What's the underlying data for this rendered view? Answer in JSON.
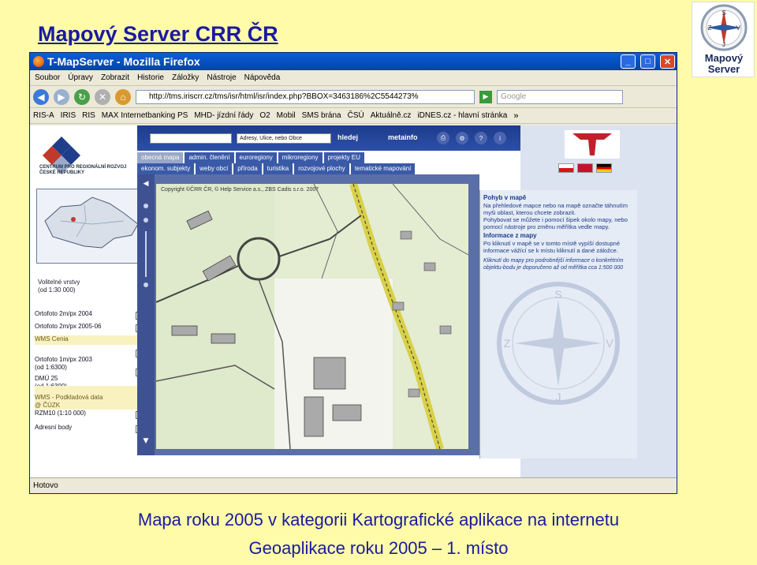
{
  "slide": {
    "title": "Mapový Server CRR ČR",
    "caption_line1": "Mapa roku 2005 v kategorii Kartografické aplikace na internetu",
    "caption_line2": "Geoaplikace roku 2005 – 1. místo"
  },
  "logo": {
    "line1": "Mapový",
    "line2": "Server",
    "compass_letters": [
      "S",
      "V",
      "J",
      "Z"
    ]
  },
  "browser": {
    "title": "T-MapServer - Mozilla Firefox",
    "menu": [
      "Soubor",
      "Úpravy",
      "Zobrazit",
      "Historie",
      "Záložky",
      "Nástroje",
      "Nápověda"
    ],
    "url": "http://tms.iriscrr.cz/tms/isr/html/isr/index.php?BBOX=3463186%2C5544273%",
    "search_placeholder": "Google",
    "bookmarks": [
      "RIS-A",
      "IRIS",
      "RIS",
      "MAX Internetbanking PS",
      "MHD- jízdní řády",
      "O2",
      "Mobil",
      "SMS brána",
      "ČSÚ",
      "Aktuálně.cz",
      "iDNES.cz - hlavní stránka"
    ],
    "bookmarks_more": "»",
    "status": "Hotovo"
  },
  "page": {
    "org_name": "CENTRUM PRO REGIONÁLNÍ ROZVOJ ČESKÉ REPUBLIKY",
    "search_select": "Adresy, Ulice, nebo Obce",
    "search_button": "hledej",
    "metainfo_button": "metainfo",
    "tabs_row1": [
      "obecná mapa",
      "admin. členění",
      "euroregiony",
      "mikroregiony",
      "projekty EU"
    ],
    "tabs_row2": [
      "ekonom. subjekty",
      "weby obcí",
      "příroda",
      "turistika",
      "rozvojové plochy",
      "tematické mapování"
    ],
    "layers_heading": "Volitelné vrstvy\n(od 1:30 000)",
    "layers": [
      {
        "label": "Ortofoto 2m/px 2004",
        "checked": false,
        "highlight": false
      },
      {
        "label": "Ortofoto 2m/px 2005-06",
        "checked": false,
        "highlight": false
      },
      {
        "label": "WMS Cenia",
        "checked": false,
        "highlight": true
      },
      {
        "label": "Ortofoto 1m/px 2003\n(od 1:6300)",
        "checked": false,
        "highlight": false
      },
      {
        "label": "DMÚ 25\n(od 1:6300)",
        "checked": false,
        "highlight": false
      },
      {
        "label": "WMS - Podkladová data\n@ ČÚZK",
        "checked": false,
        "highlight": true
      },
      {
        "label": "RZM10 (1:10 000)",
        "checked": true,
        "highlight": false
      },
      {
        "label": "Adresní body",
        "checked": false,
        "highlight": false
      }
    ],
    "map_copyright": "Copyright ©ČRR ČR, © Help Service a.s., ZBS Cadis s.r.o. 2007",
    "info": {
      "h1": "Pohyb v mapě",
      "t1": "Na přehledové mapce nebo na mapě označte táhnutím myši oblast, kterou chcete zobrazit.",
      "t2": "Pohybovat se můžete i pomocí šipek okolo mapy, nebo pomocí nástroje pro změnu měřítka vedle mapy.",
      "h2": "Informace z mapy",
      "t3": "Po kliknutí v mapě se v tomto místě vypíší dostupné informace vážící se k místu kliknutí a dané záložce.",
      "note": "Kliknutí do mapy pro podrobnější informace o konkrétním objektu-bodu je doporučeno až od měřítka cca 1:500 000"
    },
    "compass_letters": [
      "S",
      "V",
      "J",
      "Z"
    ]
  },
  "colors": {
    "slide_bg": "#fffba8",
    "title_blue": "#1a1aa0",
    "header_blue": "#1e3c8c",
    "map_green": "#e8eed8"
  }
}
